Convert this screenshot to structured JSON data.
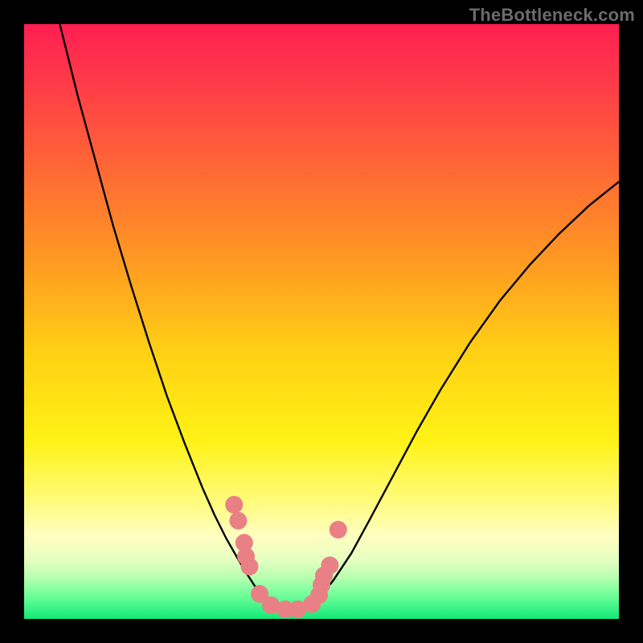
{
  "watermark": "TheBottleneck.com",
  "chart_data": {
    "type": "line",
    "title": "",
    "xlabel": "",
    "ylabel": "",
    "xlim": [
      0,
      100
    ],
    "ylim": [
      0,
      100
    ],
    "grid": false,
    "legend": false,
    "background_gradient_stops": [
      {
        "offset": 0.0,
        "color": "#ff1f52"
      },
      {
        "offset": 0.1,
        "color": "#ff3b48"
      },
      {
        "offset": 0.25,
        "color": "#ff6a34"
      },
      {
        "offset": 0.4,
        "color": "#ff9a22"
      },
      {
        "offset": 0.55,
        "color": "#ffd014"
      },
      {
        "offset": 0.7,
        "color": "#fff215"
      },
      {
        "offset": 0.8,
        "color": "#fffb7a"
      },
      {
        "offset": 0.86,
        "color": "#fffec0"
      },
      {
        "offset": 0.9,
        "color": "#e6ffc0"
      },
      {
        "offset": 0.93,
        "color": "#b8ffb0"
      },
      {
        "offset": 0.96,
        "color": "#70ff9a"
      },
      {
        "offset": 1.0,
        "color": "#12e977"
      }
    ],
    "series": [
      {
        "name": "curve-left",
        "stroke": "#000000",
        "stroke_width": 2.4,
        "points": [
          {
            "x": 6.0,
            "y": 100.0
          },
          {
            "x": 9.0,
            "y": 88.0
          },
          {
            "x": 12.0,
            "y": 77.0
          },
          {
            "x": 15.0,
            "y": 66.0
          },
          {
            "x": 18.0,
            "y": 56.0
          },
          {
            "x": 21.0,
            "y": 46.5
          },
          {
            "x": 24.0,
            "y": 37.5
          },
          {
            "x": 27.0,
            "y": 29.5
          },
          {
            "x": 30.0,
            "y": 22.0
          },
          {
            "x": 32.0,
            "y": 17.5
          },
          {
            "x": 34.0,
            "y": 13.5
          },
          {
            "x": 36.0,
            "y": 10.0
          },
          {
            "x": 37.5,
            "y": 7.5
          },
          {
            "x": 39.0,
            "y": 5.2
          },
          {
            "x": 40.5,
            "y": 3.4
          },
          {
            "x": 42.0,
            "y": 2.0
          },
          {
            "x": 43.5,
            "y": 1.2
          },
          {
            "x": 45.0,
            "y": 0.8
          }
        ]
      },
      {
        "name": "curve-right",
        "stroke": "#000000",
        "stroke_width": 2.4,
        "points": [
          {
            "x": 45.0,
            "y": 0.8
          },
          {
            "x": 46.5,
            "y": 1.2
          },
          {
            "x": 48.0,
            "y": 2.2
          },
          {
            "x": 50.0,
            "y": 4.0
          },
          {
            "x": 52.0,
            "y": 6.5
          },
          {
            "x": 55.0,
            "y": 11.0
          },
          {
            "x": 58.0,
            "y": 16.5
          },
          {
            "x": 62.0,
            "y": 24.0
          },
          {
            "x": 66.0,
            "y": 31.5
          },
          {
            "x": 70.0,
            "y": 38.5
          },
          {
            "x": 75.0,
            "y": 46.5
          },
          {
            "x": 80.0,
            "y": 53.5
          },
          {
            "x": 85.0,
            "y": 59.5
          },
          {
            "x": 90.0,
            "y": 64.8
          },
          {
            "x": 95.0,
            "y": 69.5
          },
          {
            "x": 100.0,
            "y": 73.5
          }
        ]
      }
    ],
    "markers": {
      "name": "bottleneck-markers",
      "color": "#e98085",
      "radius": 11,
      "points": [
        {
          "x": 35.3,
          "y": 19.2
        },
        {
          "x": 36.0,
          "y": 16.5
        },
        {
          "x": 37.0,
          "y": 12.8
        },
        {
          "x": 37.3,
          "y": 10.5
        },
        {
          "x": 37.9,
          "y": 8.8
        },
        {
          "x": 39.6,
          "y": 4.2
        },
        {
          "x": 41.5,
          "y": 2.3
        },
        {
          "x": 43.9,
          "y": 1.6
        },
        {
          "x": 46.0,
          "y": 1.6
        },
        {
          "x": 48.4,
          "y": 2.5
        },
        {
          "x": 49.6,
          "y": 4.0
        },
        {
          "x": 50.0,
          "y": 5.7
        },
        {
          "x": 50.4,
          "y": 7.3
        },
        {
          "x": 51.4,
          "y": 9.0
        },
        {
          "x": 52.8,
          "y": 15.0
        }
      ]
    }
  }
}
